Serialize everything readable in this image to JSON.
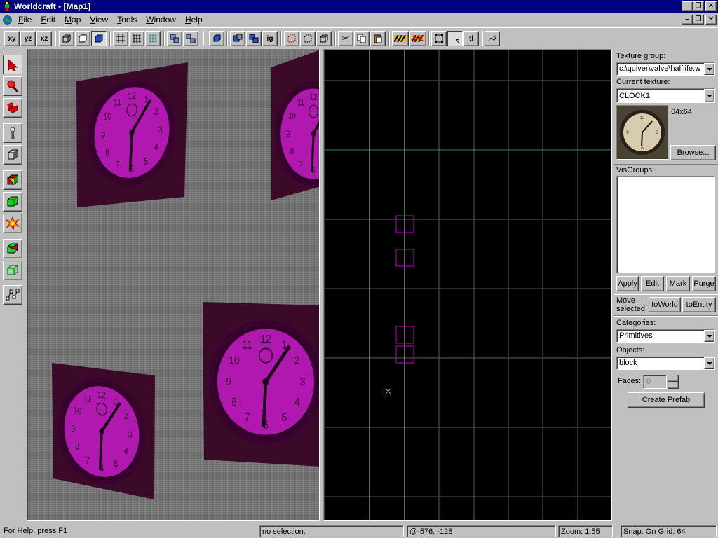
{
  "window": {
    "title": "Worldcraft - [Map1]"
  },
  "menu": {
    "items": [
      "File",
      "Edit",
      "Map",
      "View",
      "Tools",
      "Window",
      "Help"
    ]
  },
  "toolbar": {
    "view_buttons": [
      "xy",
      "yz",
      "xz"
    ],
    "ig_label": "ig",
    "tl_label": "tl"
  },
  "left_tools": [
    "pointer",
    "camera",
    "magnify",
    "entity",
    "block",
    "texture-apply",
    "apply-current",
    "decal",
    "clipping",
    "vertex",
    "path"
  ],
  "right_panel": {
    "texture_group_label": "Texture group:",
    "texture_group_value": "c:\\quiver\\valve\\halflife.w",
    "current_texture_label": "Current texture:",
    "current_texture_value": "CLOCK1",
    "texture_size": "64x64",
    "browse_label": "Browse...",
    "visgroups_label": "VisGroups:",
    "apply_label": "Apply",
    "edit_label": "Edit",
    "mark_label": "Mark",
    "purge_label": "Purge",
    "move_selected_label": "Move selected:",
    "to_world_label": "toWorld",
    "to_entity_label": "toEntity",
    "categories_label": "Categories:",
    "categories_value": "Primitives",
    "objects_label": "Objects:",
    "objects_value": "block",
    "faces_label": "Faces:",
    "faces_value": "0",
    "create_prefab_label": "Create Prefab"
  },
  "status": {
    "help": "For Help, press F1",
    "selection": "no selection.",
    "coords": "@-576, -128",
    "zoom": "Zoom: 1.55",
    "snap": "Snap: On Grid: 64"
  },
  "colors": {
    "title_bar": "#000080",
    "selection_box": "#c000c0",
    "grid_line": "#5a5a5a",
    "grid_axis": "#c8c8c8",
    "grid_teal": "#2a7a7a",
    "clock_face": "#c020c0"
  }
}
